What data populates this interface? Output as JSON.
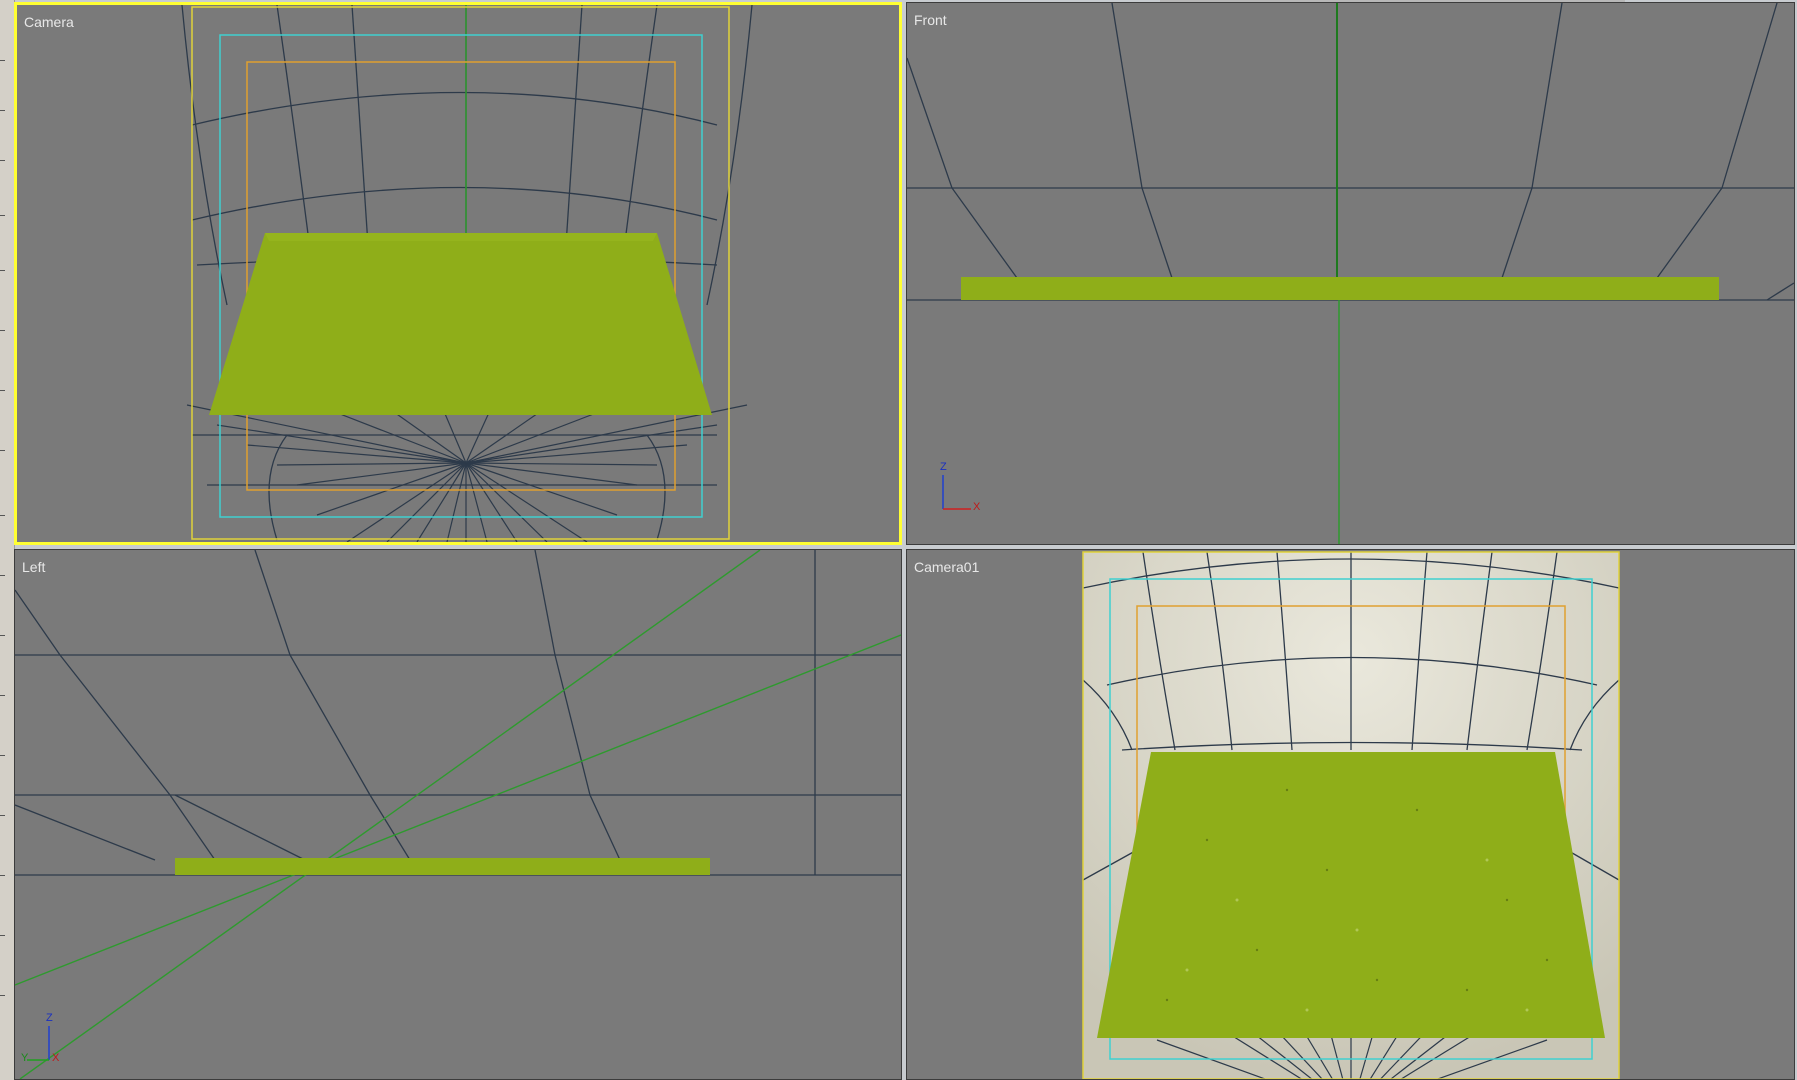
{
  "viewports": {
    "top_left": {
      "label": "Camera",
      "active": true
    },
    "top_right": {
      "label": "Front",
      "active": false
    },
    "bottom_left": {
      "label": "Left",
      "active": false
    },
    "bottom_right": {
      "label": "Camera01",
      "active": false
    }
  },
  "axis_labels": {
    "z": "Z",
    "x": "X",
    "y": "Y"
  },
  "colors": {
    "viewport_bg": "#7a7a7a",
    "active_border": "#ffff33",
    "grid_line": "#2d3a4a",
    "grass": "#8fae19",
    "safe_frame_outer": "#e0d23a",
    "safe_frame_action": "#3fd0d0",
    "safe_frame_title": "#e0a030",
    "camera_line": "#2e9a2e",
    "render_bg": "#d8d5c8"
  }
}
